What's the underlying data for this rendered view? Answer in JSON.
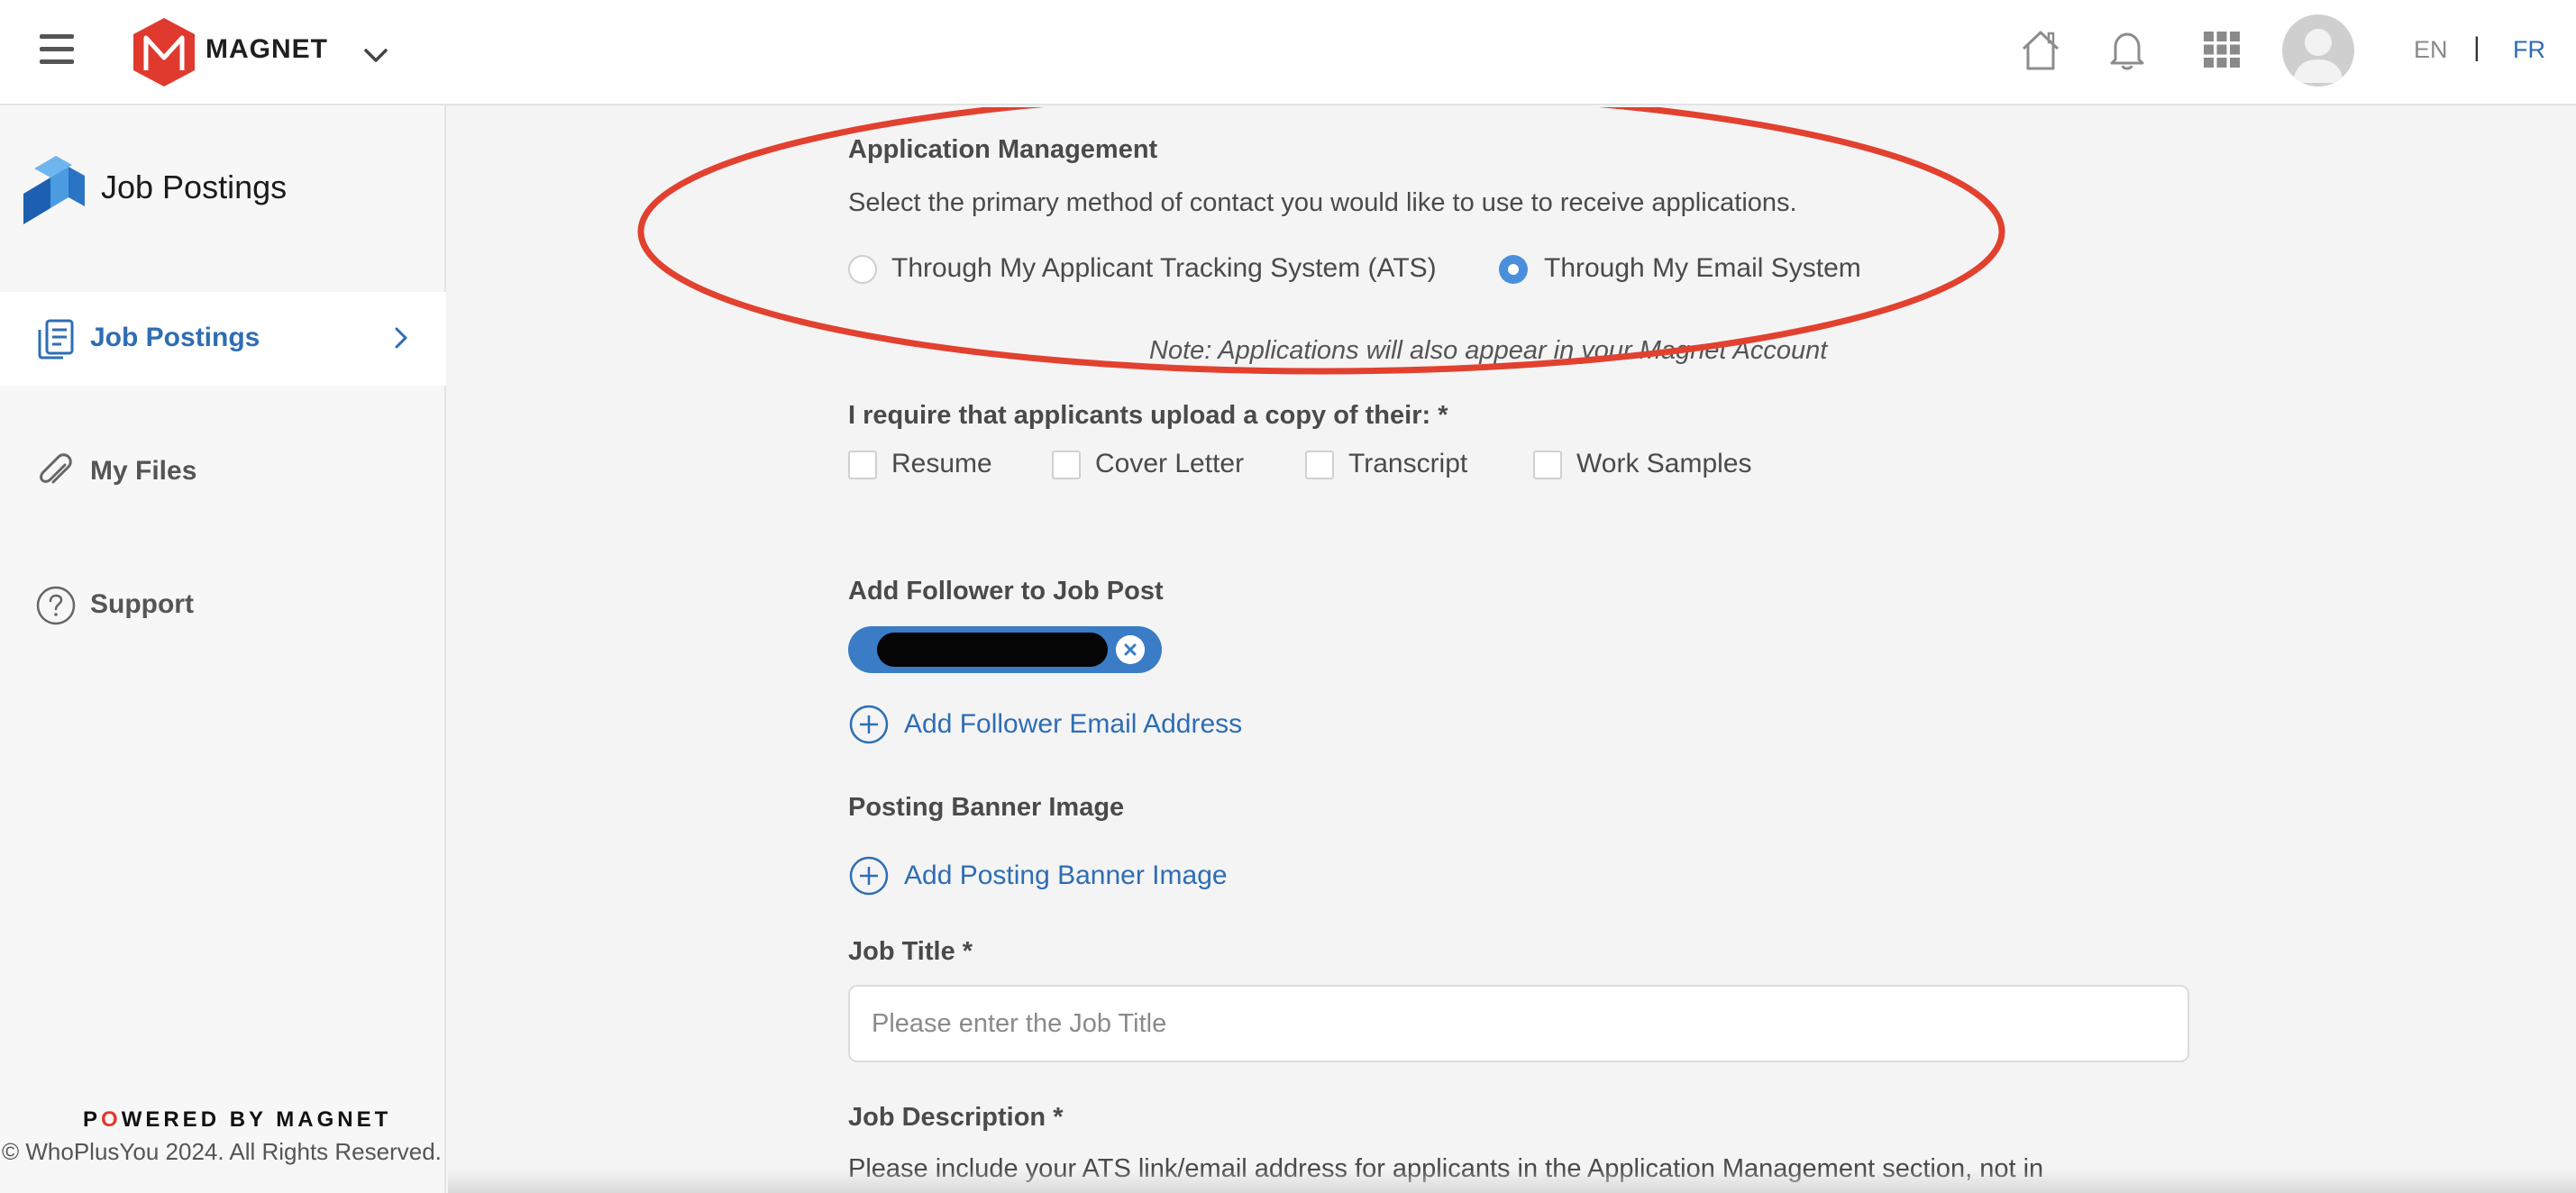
{
  "header": {
    "brand_name": "MAGNET",
    "lang_en": "EN",
    "lang_separator": "|",
    "lang_fr": "FR",
    "icons": [
      "menu-icon",
      "magnet-logo-icon",
      "chevron-down-icon",
      "home-icon",
      "bell-icon",
      "apps-grid-icon",
      "avatar"
    ]
  },
  "sidebar": {
    "app_title": "Job Postings",
    "items": [
      {
        "label": "Job Postings",
        "icon": "document-icon",
        "active": true
      },
      {
        "label": "My Files",
        "icon": "paperclip-icon",
        "active": false
      },
      {
        "label": "Support",
        "icon": "help-icon",
        "active": false
      }
    ],
    "powered_prefix": "P",
    "powered_o": "O",
    "powered_suffix": "WERED BY MAGNET",
    "copyright": "© WhoPlusYou 2024. All Rights Reserved."
  },
  "form": {
    "app_mgmt_heading": "Application Management",
    "app_mgmt_desc": "Select the primary method of contact you would like to use to receive applications.",
    "contact_options": [
      {
        "label": "Through My Applicant Tracking System (ATS)",
        "checked": false
      },
      {
        "label": "Through My Email System",
        "checked": true
      }
    ],
    "note": "Note: Applications will also appear in your Magnet Account",
    "upload_heading": "I require that applicants upload a copy of their: *",
    "upload_options": [
      {
        "label": "Resume",
        "checked": false
      },
      {
        "label": "Cover Letter",
        "checked": false
      },
      {
        "label": "Transcript",
        "checked": false
      },
      {
        "label": "Work Samples",
        "checked": false
      }
    ],
    "follower_heading": "Add Follower to Job Post",
    "add_follower_label": "Add Follower Email Address",
    "banner_heading": "Posting Banner Image",
    "add_banner_label": "Add Posting Banner Image",
    "job_title_heading": "Job Title *",
    "job_title_value": "",
    "job_title_placeholder": "Please enter the Job Title",
    "job_desc_heading": "Job Description *",
    "job_desc_text": "Please include your ATS link/email address for applicants in the Application Management section, not in"
  },
  "colors": {
    "accent_blue": "#2e6db4",
    "radio_blue": "#4a8fdc",
    "chip_blue": "#3a7cc6",
    "annotation_red": "#e2412f",
    "brand_red": "#e03a2f"
  }
}
